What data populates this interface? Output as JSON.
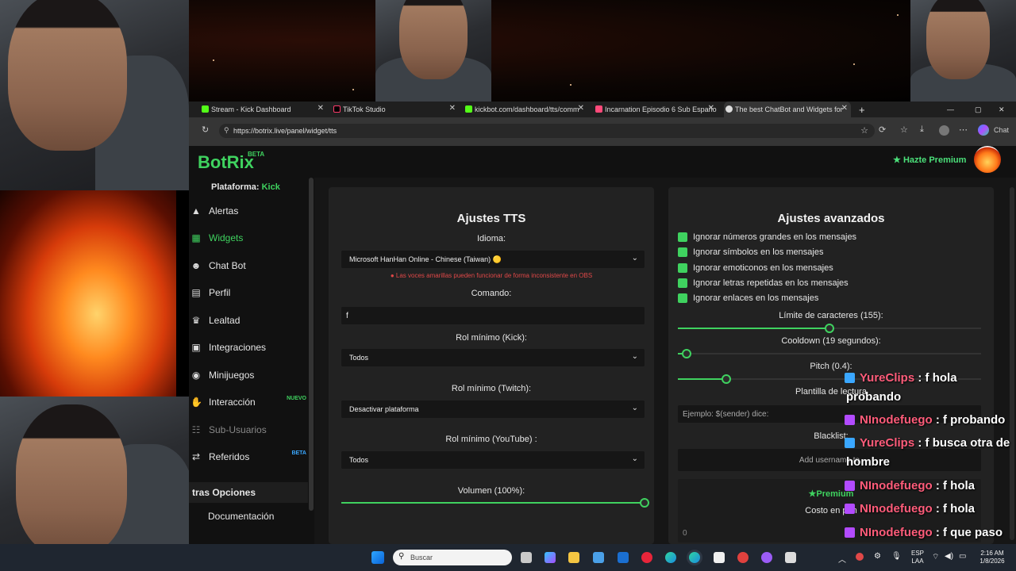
{
  "browser": {
    "tabs": [
      {
        "label": "Stream - Kick Dashboard",
        "color": "#53fc18"
      },
      {
        "label": "TikTok Studio",
        "color": "#111111"
      },
      {
        "label": "kickbot.com/dashboard/tts/comm",
        "color": "#53fc18"
      },
      {
        "label": "Incarnation Episodio 6 Sub Españo",
        "color": "#ff4a7a"
      },
      {
        "label": "The best ChatBot and Widgets for",
        "color": "#3fd25f"
      }
    ],
    "new_tab": "+",
    "url": "https://botrix.live/panel/widget/tts",
    "chat_button": "Chat"
  },
  "app": {
    "logo": "BotRix",
    "logo_badge": "BETA",
    "premium_button": "Hazte Premium",
    "accent": "#3fd25f"
  },
  "sidebar": {
    "platform_label": "Plataforma:",
    "platform_value": "Kick",
    "items": [
      {
        "label": "Alertas",
        "icon": "warning-icon"
      },
      {
        "label": "Widgets",
        "icon": "grid-icon"
      },
      {
        "label": "Chat Bot",
        "icon": "robot-icon"
      },
      {
        "label": "Perfil",
        "icon": "id-card-icon"
      },
      {
        "label": "Lealtad",
        "icon": "trophy-icon"
      },
      {
        "label": "Integraciones",
        "icon": "plug-icon"
      },
      {
        "label": "Minijuegos",
        "icon": "gamepad-icon"
      },
      {
        "label": "Interacción",
        "icon": "hand-icon",
        "badge": "NUEVO"
      },
      {
        "label": "Sub-Usuarios",
        "icon": "users-icon"
      },
      {
        "label": "Referidos",
        "icon": "share-icon",
        "badge": "BETA"
      }
    ],
    "section_title": "tras Opciones",
    "doc_label": "Documentación"
  },
  "tts": {
    "title": "Ajustes TTS",
    "language_label": "Idioma:",
    "language_value": "Microsoft HanHan Online - Chinese (Taiwan) 🟡",
    "warning": "Las voces amarillas pueden funcionar de forma inconsistente en OBS",
    "command_label": "Comando:",
    "command_value": "f",
    "kick_role_label": "Rol mínimo (Kick):",
    "kick_role_value": "Todos",
    "twitch_role_label": "Rol mínimo (Twitch):",
    "twitch_role_value": "Desactivar plataforma",
    "youtube_role_label": "Rol mínimo (YouTube) :",
    "youtube_role_value": "Todos",
    "volume_label": "Volumen (100%):",
    "volume_fraction": 1.0
  },
  "advanced": {
    "title": "Ajustes avanzados",
    "checks": [
      "Ignorar números grandes en los mensajes",
      "Ignorar símbolos en los mensajes",
      "Ignorar emoticonos en los mensajes",
      "Ignorar letras repetidas en los mensajes",
      "Ignorar enlaces en los mensajes"
    ],
    "char_limit_label": "Límite de caracteres (155):",
    "char_limit_fraction": 0.5,
    "cooldown_label": "Cooldown (19 segundos):",
    "cooldown_fraction": 0.03,
    "pitch_label": "Pitch (0.4):",
    "pitch_fraction": 0.16,
    "template_label": "Plantilla de lectura",
    "template_placeholder": "Ejemplo: $(sender) dice:",
    "blacklist_label": "Blacklist:",
    "blacklist_placeholder": "Add username to",
    "premium_badge": "Premium",
    "cost_label": "Costo en pun",
    "cost_value": "0"
  },
  "chat": [
    {
      "name": "YureClips",
      "sep": " : ",
      "msg": "f hola",
      "icon_color": "#3aa7ff"
    },
    {
      "name": "",
      "sep": "",
      "msg": "probando",
      "icon_color": ""
    },
    {
      "name": "NInodefuego",
      "sep": " : ",
      "msg": "f probando",
      "icon_color": "#b24bff"
    },
    {
      "name": "YureClips",
      "sep": " : ",
      "msg": "f busca otra de",
      "icon_color": "#3aa7ff"
    },
    {
      "name": "",
      "sep": "",
      "msg": "hombre",
      "icon_color": ""
    },
    {
      "name": "NInodefuego",
      "sep": " : ",
      "msg": "f hola",
      "icon_color": "#b24bff"
    },
    {
      "name": "NInodefuego",
      "sep": " : ",
      "msg": "f hola",
      "icon_color": "#b24bff"
    },
    {
      "name": "NInodefuego",
      "sep": " : ",
      "msg": "f que paso",
      "icon_color": "#b24bff"
    }
  ],
  "taskbar": {
    "search_placeholder": "Buscar",
    "lang_top": "ESP",
    "lang_bottom": "LAA",
    "time": "2:16 AM",
    "date": "1/8/2026"
  }
}
